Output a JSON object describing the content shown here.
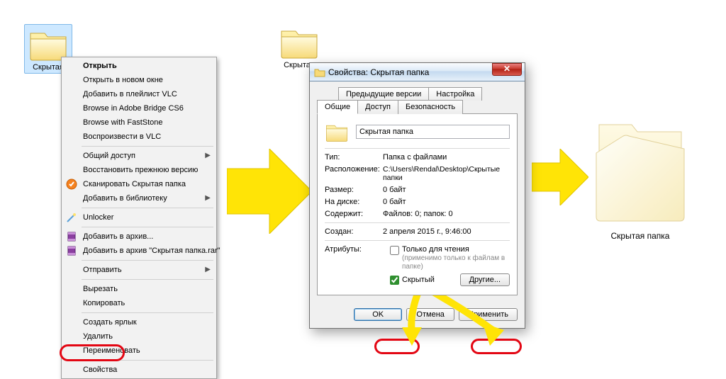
{
  "folders": {
    "left": {
      "label": "Скрытая"
    },
    "middle": {
      "label": "Скрытая"
    },
    "right": {
      "label": "Скрытая папка"
    }
  },
  "context_menu": {
    "items": [
      {
        "label": "Открыть",
        "bold": true
      },
      {
        "label": "Открыть в новом окне"
      },
      {
        "label": "Добавить в плейлист VLC"
      },
      {
        "label": "Browse in Adobe Bridge CS6"
      },
      {
        "label": "Browse with FastStone"
      },
      {
        "label": "Воспроизвести в VLC"
      }
    ],
    "items2": [
      {
        "label": "Общий доступ",
        "submenu": true
      },
      {
        "label": "Восстановить прежнюю версию"
      },
      {
        "label": "Сканировать Скрытая папка",
        "icon": "scan"
      },
      {
        "label": "Добавить в библиотеку",
        "submenu": true
      }
    ],
    "items3": [
      {
        "label": "Unlocker",
        "icon": "unlocker"
      }
    ],
    "items4": [
      {
        "label": "Добавить в архив...",
        "icon": "rar"
      },
      {
        "label": "Добавить в архив \"Скрытая папка.rar\"",
        "icon": "rar"
      }
    ],
    "items5": [
      {
        "label": "Отправить",
        "submenu": true
      }
    ],
    "items6": [
      {
        "label": "Вырезать"
      },
      {
        "label": "Копировать"
      }
    ],
    "items7": [
      {
        "label": "Создать ярлык"
      },
      {
        "label": "Удалить"
      },
      {
        "label": "Переименовать"
      }
    ],
    "items8": [
      {
        "label": "Свойства"
      }
    ]
  },
  "dialog": {
    "title": "Свойства: Скрытая папка",
    "tabs": {
      "prev_versions": "Предыдущие версии",
      "settings": "Настройка",
      "general": "Общие",
      "access": "Доступ",
      "security": "Безопасность"
    },
    "name_value": "Скрытая папка",
    "fields": {
      "type_k": "Тип:",
      "type_v": "Папка с файлами",
      "loc_k": "Расположение:",
      "loc_v": "C:\\Users\\Rendal\\Desktop\\Скрытые папки",
      "size_k": "Размер:",
      "size_v": "0 байт",
      "disk_k": "На диске:",
      "disk_v": "0 байт",
      "cont_k": "Содержит:",
      "cont_v": "Файлов: 0; папок: 0",
      "created_k": "Создан:",
      "created_v": "2 апреля 2015 г., 9:46:00"
    },
    "attrs": {
      "label": "Атрибуты:",
      "readonly": "Только для чтения",
      "readonly_note": "(применимо только к файлам в папке)",
      "hidden": "Скрытый",
      "other_btn": "Другие..."
    },
    "buttons": {
      "ok": "OK",
      "cancel": "Отмена",
      "apply": "Применить"
    }
  }
}
